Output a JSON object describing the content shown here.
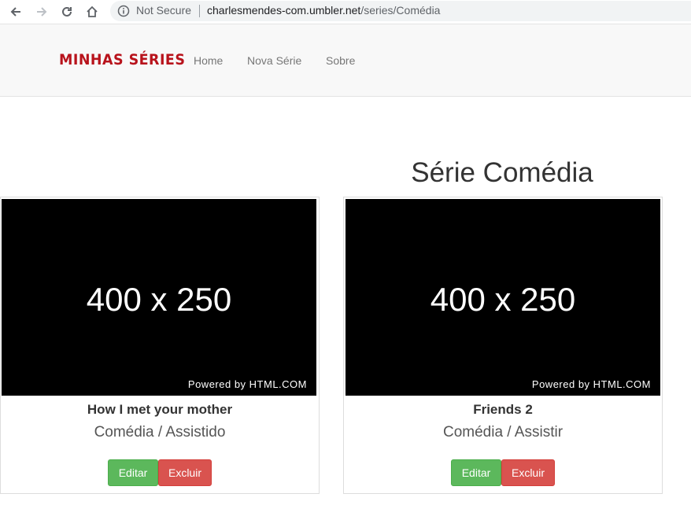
{
  "browser": {
    "security_label": "Not Secure",
    "url_host": "charlesmendes-com.umbler.net",
    "url_path": "/series/Comédia"
  },
  "header": {
    "brand": "MINHAS SÉRIES",
    "nav": [
      {
        "label": "Home"
      },
      {
        "label": "Nova Série"
      },
      {
        "label": "Sobre"
      }
    ]
  },
  "page": {
    "title": "Série Comédia"
  },
  "series": [
    {
      "image_text": "400 x 250",
      "image_credit": "Powered by HTML.COM",
      "name": "How I met your mother",
      "meta": "Comédia / Assistido",
      "edit_label": "Editar",
      "delete_label": "Excluir"
    },
    {
      "image_text": "400 x 250",
      "image_credit": "Powered by HTML.COM",
      "name": "Friends 2",
      "meta": "Comédia / Assistir",
      "edit_label": "Editar",
      "delete_label": "Excluir"
    }
  ],
  "colors": {
    "brand": "#b8131c",
    "edit_button": "#5cb85c",
    "delete_button": "#d9534f"
  }
}
